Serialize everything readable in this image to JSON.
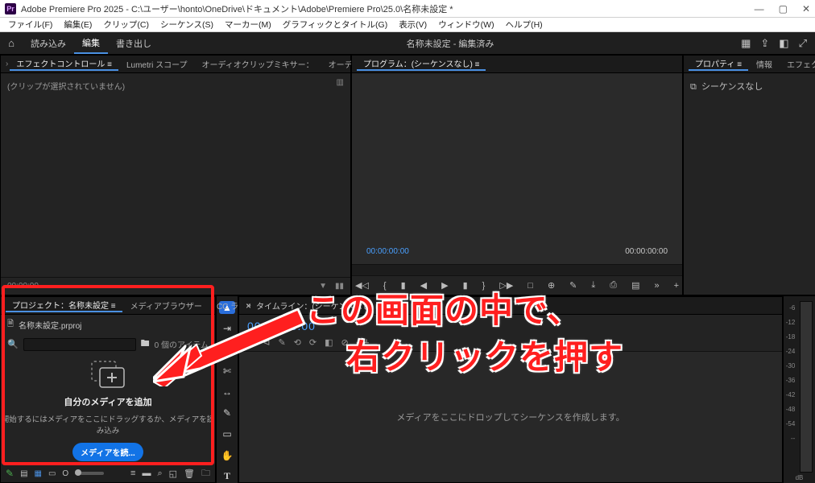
{
  "window": {
    "app_badge": "Pr",
    "title": "Adobe Premiere Pro 2025 - C:\\ユーザー\\honto\\OneDrive\\ドキュメント\\Adobe\\Premiere Pro\\25.0\\名称未設定 *"
  },
  "win_buttons": {
    "min": "—",
    "max": "▢",
    "close": "✕"
  },
  "menubar": [
    "ファイル(F)",
    "編集(E)",
    "クリップ(C)",
    "シーケンス(S)",
    "マーカー(M)",
    "グラフィックとタイトル(G)",
    "表示(V)",
    "ウィンドウ(W)",
    "ヘルプ(H)"
  ],
  "workspace": {
    "home_icon": "⌂",
    "items": [
      "読み込み",
      "編集",
      "書き出し"
    ],
    "active_index": 1,
    "center_title": "名称未設定 - 編集済み",
    "right_icons": [
      "▦",
      "⇪",
      "◧",
      "⤢"
    ]
  },
  "effect_controls": {
    "tabs": [
      "エフェクトコントロール",
      "Lumetri スコープ",
      "オーディオクリップミキサー：",
      "オーディオト"
    ],
    "overflow": "≡  »",
    "empty_text": "(クリップが選択されていません)",
    "page_icon": "▥",
    "footer_time": "00:00:00",
    "footer_search": "▼",
    "footer_tl": "▮▮"
  },
  "program": {
    "tab_label": "プログラム：(シーケンスなし) ≡",
    "tc_left": "00:00:00:00",
    "tc_right": "00:00:00:00",
    "controls": [
      "◀◁",
      "{",
      "▮",
      "◀",
      "▶",
      "▮",
      "}",
      "▷▶",
      "□",
      "⊕",
      "✎",
      "⤓",
      "⎙",
      "▤",
      "»",
      "+"
    ]
  },
  "properties": {
    "tabs": [
      "プロパティ ≡",
      "情報",
      "エフェクト"
    ],
    "overflow": "»",
    "icon": "⧉",
    "text": "シーケンスなし"
  },
  "project": {
    "tabs": [
      "プロジェクト：名称未設定 ≡",
      "メディアブラウザー",
      "CC ラ"
    ],
    "overflow": "»",
    "file_icon": "🗎",
    "file_name": "名称未設定.prproj",
    "search_icon": "🔍",
    "bin_icon": "🖿",
    "item_count": "0 個のアイテム",
    "empty_title": "自分のメディアを追加",
    "empty_sub": "開始するにはメディアをここにドラッグするか、メディアを読み込み",
    "import_btn": "メディアを読...",
    "footer_icons_left": [
      "✎",
      "▤",
      "▦",
      "▭"
    ],
    "footer_center": "O",
    "footer_icons_right": [
      "≡",
      "▬",
      "⌕",
      "◱",
      "🗑",
      "🗀"
    ]
  },
  "tools": {
    "items": [
      {
        "name": "selection-tool",
        "glyph": "▲",
        "sel": true
      },
      {
        "name": "track-select-tool",
        "glyph": "⇥",
        "sel": false
      },
      {
        "name": "ripple-edit-tool",
        "glyph": "⇆",
        "sel": false
      },
      {
        "name": "razor-tool",
        "glyph": "✄",
        "sel": false
      },
      {
        "name": "slip-tool",
        "glyph": "↔",
        "sel": false
      },
      {
        "name": "pen-tool",
        "glyph": "✎",
        "sel": false
      },
      {
        "name": "rectangle-tool",
        "glyph": "▭",
        "sel": false
      },
      {
        "name": "hand-tool",
        "glyph": "✋",
        "sel": false
      },
      {
        "name": "type-tool",
        "glyph": "T",
        "sel": false
      }
    ]
  },
  "timeline": {
    "close_icon": "×",
    "tab_label": "タイムライン：(シーケンスなし) ≡",
    "timecode": "00:00:00:00",
    "controls": [
      "⊳",
      "⊲",
      "✎",
      "⟲",
      "⟳",
      "◧",
      "⊘",
      "ᚊ"
    ],
    "drop_text": "メディアをここにドロップしてシーケンスを作成します。"
  },
  "meter": {
    "ticks": [
      "-6",
      "-12",
      "-18",
      "-24",
      "-30",
      "-36",
      "-42",
      "-48",
      "-54",
      "--"
    ],
    "label": "dB"
  },
  "annotation": {
    "line1": "この画面の中で、",
    "line2": "右クリックを押す"
  }
}
